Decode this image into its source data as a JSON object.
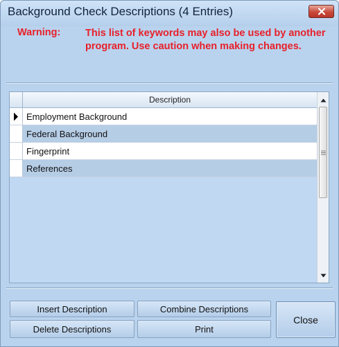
{
  "window": {
    "title": "Background Check Descriptions (4 Entries)"
  },
  "warning": {
    "label": "Warning:",
    "text": "This list of keywords may also be used by another program. Use caution when making changes."
  },
  "grid": {
    "column_header": "Description",
    "rows": [
      {
        "description": "Employment Background",
        "selected": true
      },
      {
        "description": "Federal Background",
        "selected": false
      },
      {
        "description": "Fingerprint",
        "selected": false
      },
      {
        "description": "References",
        "selected": false
      }
    ]
  },
  "buttons": {
    "insert": "Insert Description",
    "combine": "Combine Descriptions",
    "delete": "Delete Descriptions",
    "print": "Print",
    "close": "Close"
  },
  "icons": {
    "close": "close-icon",
    "row_indicator": "row-pointer-icon",
    "scroll_up": "scroll-up-arrow-icon",
    "scroll_down": "scroll-down-arrow-icon",
    "scroll_grip": "grip-icon"
  },
  "colors": {
    "window_bg": "#b9d3ee",
    "warning": "#e8202a",
    "alt_row": "#b6cde6"
  }
}
